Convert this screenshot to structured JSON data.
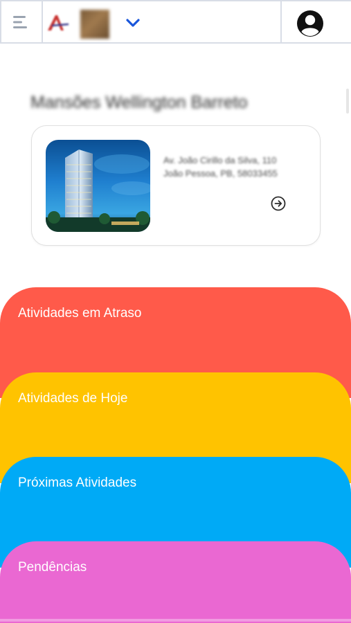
{
  "header": {
    "menu_icon": "hamburger-menu-icon",
    "logo_icon": "company-logo-icon",
    "selector_icon": "chevron-down-icon",
    "account_icon": "user-avatar-icon",
    "accent_color": "#1a56db"
  },
  "project": {
    "title": "Mansões Wellington Barreto",
    "address_line1": "Av. João Cirillo da Silva, 110",
    "address_line2": "João Pessoa, PB, 58033455",
    "go_icon": "arrow-right-circle-icon"
  },
  "activities": [
    {
      "label": "Atividades em Atraso",
      "color": "#ff5a4a"
    },
    {
      "label": "Atividades de Hoje",
      "color": "#ffc300"
    },
    {
      "label": "Próximas Atividades",
      "color": "#00aaf6"
    },
    {
      "label": "Pendências",
      "color": "#ea68d2"
    }
  ]
}
